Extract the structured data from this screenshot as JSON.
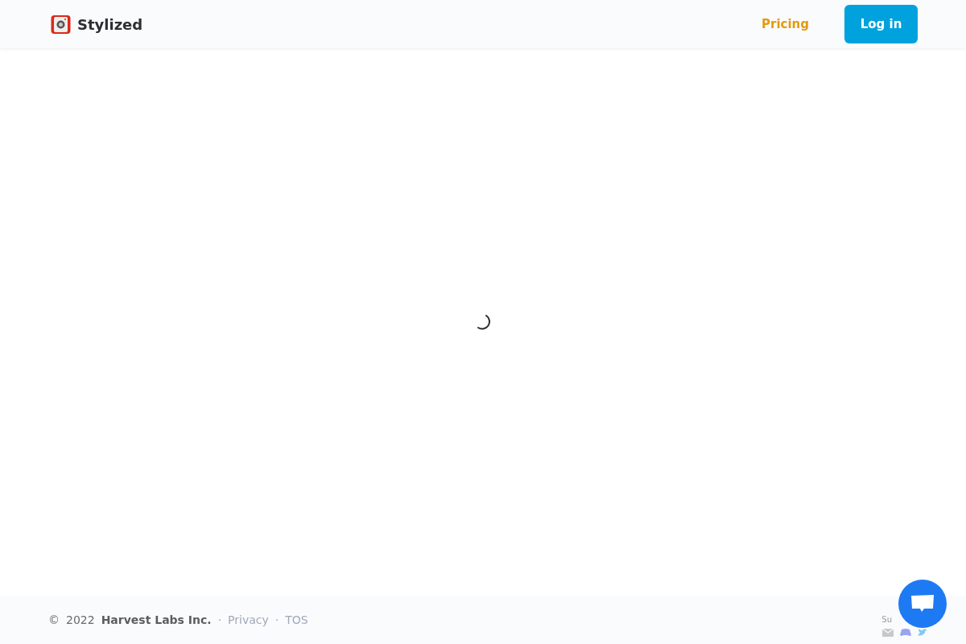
{
  "header": {
    "brand": "Stylized",
    "nav": [
      {
        "label": "Pricing",
        "kind": "link"
      },
      {
        "label": "Log in",
        "kind": "button"
      }
    ]
  },
  "content": {
    "loading": true
  },
  "footer": {
    "copyright": "©",
    "year": "2022",
    "company": "Harvest Labs Inc.",
    "separator": "·",
    "links": [
      "Privacy",
      "TOS"
    ],
    "support_label": "Su"
  }
}
